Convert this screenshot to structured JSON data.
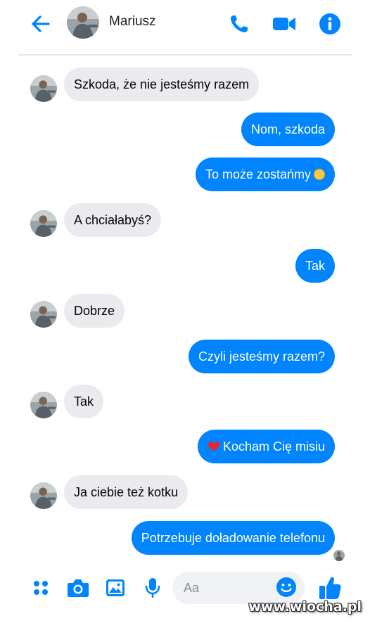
{
  "header": {
    "contact_name": "Mariusz",
    "back_icon": "arrow-left-icon",
    "call_icon": "phone-icon",
    "video_icon": "video-camera-icon",
    "info_icon": "info-icon"
  },
  "messages": [
    {
      "side": "in",
      "text": "Szkoda, że nie jesteśmy razem"
    },
    {
      "side": "out",
      "text": "Nom, szkoda"
    },
    {
      "side": "out",
      "text": "To może zostańmy",
      "emoji": "slightly-smiling-face"
    },
    {
      "side": "in",
      "text": "A chciałabyś?"
    },
    {
      "side": "out",
      "text": "Tak"
    },
    {
      "side": "in",
      "text": "Dobrze"
    },
    {
      "side": "out",
      "text": "Czyli jesteśmy razem?"
    },
    {
      "side": "in",
      "text": "Tak"
    },
    {
      "side": "out",
      "text": "Kocham Cię misiu",
      "emoji": "red-heart"
    },
    {
      "side": "in",
      "text": "Ja ciebie też kotku"
    },
    {
      "side": "out",
      "text": "Potrzebuje doładowanie telefonu"
    }
  ],
  "composer": {
    "placeholder": "Aa",
    "icons": [
      "menu-dots-icon",
      "camera-icon",
      "image-icon",
      "microphone-icon",
      "emoji-icon",
      "like-thumb-icon"
    ]
  },
  "watermark": "www.wiocha.pl",
  "colors": {
    "accent": "#0084ff",
    "incoming_bubble": "#e9ebee",
    "composer_field": "#f0f2f5"
  }
}
